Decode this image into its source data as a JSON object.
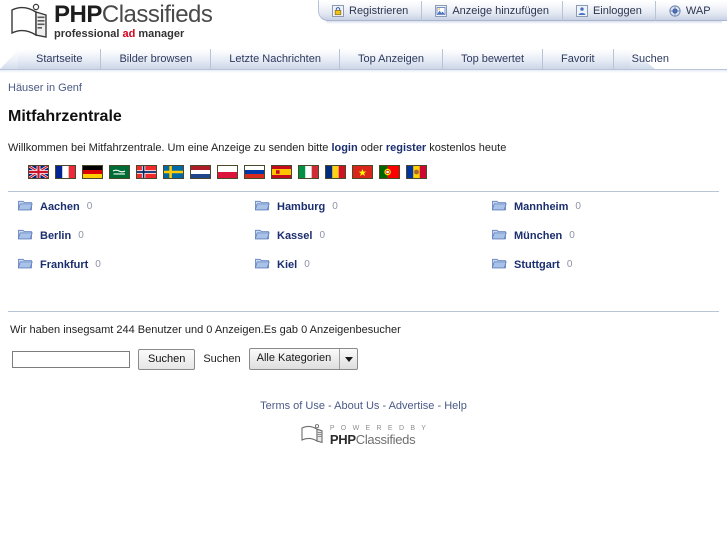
{
  "header": {
    "logo_php": "PHP",
    "logo_classifieds": "Classifieds",
    "tagline_pre": "professional ",
    "tagline_ad": "ad",
    "tagline_post": " manager"
  },
  "topbar": {
    "items": [
      {
        "label": "Registrieren",
        "icon": "lock-icon"
      },
      {
        "label": "Anzeige hinzufügen",
        "icon": "image-add-icon"
      },
      {
        "label": "Einloggen",
        "icon": "user-login-icon"
      },
      {
        "label": "WAP",
        "icon": "globe-icon"
      }
    ]
  },
  "tabs": [
    {
      "label": "Startseite"
    },
    {
      "label": "Bilder browsen"
    },
    {
      "label": "Letzte Nachrichten"
    },
    {
      "label": "Top Anzeigen"
    },
    {
      "label": "Top bewertet"
    },
    {
      "label": "Favorit"
    },
    {
      "label": "Suchen"
    }
  ],
  "breadcrumb": "Häuser in Genf",
  "page_title": "Mitfahrzentrale",
  "welcome": {
    "pre": "Willkommen bei Mitfahrzentrale. Um eine Anzeige zu senden bitte ",
    "login": "login",
    "mid": " oder ",
    "register": "register",
    "post": " kostenlos heute"
  },
  "flags": [
    {
      "name": "flag-united-kingdom"
    },
    {
      "name": "flag-france"
    },
    {
      "name": "flag-germany"
    },
    {
      "name": "flag-saudi-arabia"
    },
    {
      "name": "flag-norway"
    },
    {
      "name": "flag-sweden"
    },
    {
      "name": "flag-netherlands"
    },
    {
      "name": "flag-poland"
    },
    {
      "name": "flag-russia"
    },
    {
      "name": "flag-spain"
    },
    {
      "name": "flag-italy"
    },
    {
      "name": "flag-romania"
    },
    {
      "name": "flag-vietnam"
    },
    {
      "name": "flag-portugal"
    },
    {
      "name": "flag-moldova"
    }
  ],
  "categories": [
    {
      "name": "Aachen",
      "count": "0"
    },
    {
      "name": "Hamburg",
      "count": "0"
    },
    {
      "name": "Mannheim",
      "count": "0"
    },
    {
      "name": "Berlin",
      "count": "0"
    },
    {
      "name": "Kassel",
      "count": "0"
    },
    {
      "name": "München",
      "count": "0"
    },
    {
      "name": "Frankfurt",
      "count": "0"
    },
    {
      "name": "Kiel",
      "count": "0"
    },
    {
      "name": "Stuttgart",
      "count": "0"
    }
  ],
  "stats": "Wir haben insegsamt 244 Benutzer und 0 Anzeigen.Es gab 0 Anzeigenbesucher",
  "search": {
    "value": "",
    "placeholder": "",
    "button_label": "Suchen",
    "label": "Suchen",
    "category_selected": "Alle Kategorien"
  },
  "footer": {
    "links": [
      "Terms of Use",
      "About Us",
      "Advertise",
      "Help"
    ],
    "separator": " - ",
    "powered_by": "P O W E R E D   B Y",
    "powered_php": "PHP",
    "powered_classifieds": "Classifieds"
  },
  "colors": {
    "link": "#1b2e6e",
    "breadcrumb": "#4b5a86",
    "tab_text": "#2d3a5e",
    "accent_red": "#d6001c",
    "rule": "#b9c4d8"
  }
}
